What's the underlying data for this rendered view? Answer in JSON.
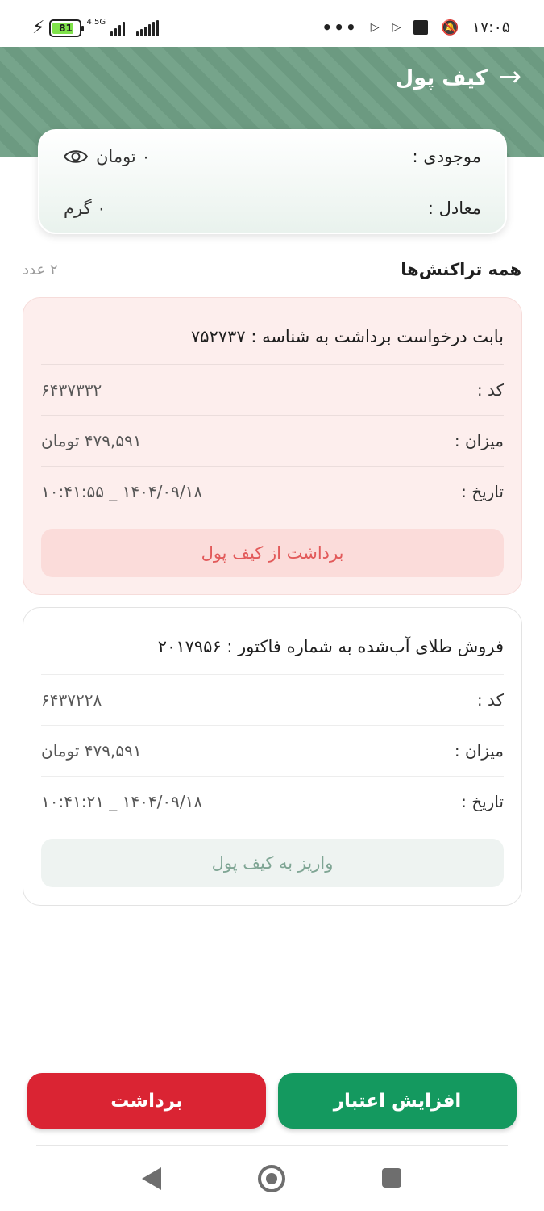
{
  "status_bar": {
    "battery_level": "81",
    "network_type": "4.5G",
    "time": "۱۷:۰۵"
  },
  "header": {
    "title": "کیف پول"
  },
  "balance": {
    "label": "موجودی :",
    "value": "۰ تومان",
    "equivalent_label": "معادل :",
    "equivalent_value": "۰ گرم"
  },
  "transactions_header": {
    "title": "همه تراکنش‌ها",
    "count": "۲ عدد"
  },
  "transactions": [
    {
      "title": "بابت درخواست برداشت به شناسه : ۷۵۲۷۳۷",
      "code_label": "کد :",
      "code_value": "۶۴۳۷۳۳۲",
      "amount_label": "میزان :",
      "amount_value": "۴۷۹,۵۹۱ تومان",
      "date_label": "تاریخ :",
      "date_value": "۱۴۰۴/۰۹/۱۸ _ ۱۰:۴۱:۵۵",
      "type": "برداشت از کیف پول"
    },
    {
      "title": "فروش طلای آب‌شده به شماره فاکتور : ۲۰۱۷۹۵۶",
      "code_label": "کد :",
      "code_value": "۶۴۳۷۲۲۸",
      "amount_label": "میزان :",
      "amount_value": "۴۷۹,۵۹۱ تومان",
      "date_label": "تاریخ :",
      "date_value": "۱۴۰۴/۰۹/۱۸ _ ۱۰:۴۱:۲۱",
      "type": "واریز به کیف پول"
    }
  ],
  "actions": {
    "increase_credit": "افزایش اعتبار",
    "withdraw": "برداشت"
  },
  "colors": {
    "header_green": "#6f9f85",
    "credit_button": "#14995f",
    "withdraw_button": "#da2433",
    "withdraw_card_bg": "#fdeeed",
    "withdraw_type_text": "#e25a5a"
  }
}
